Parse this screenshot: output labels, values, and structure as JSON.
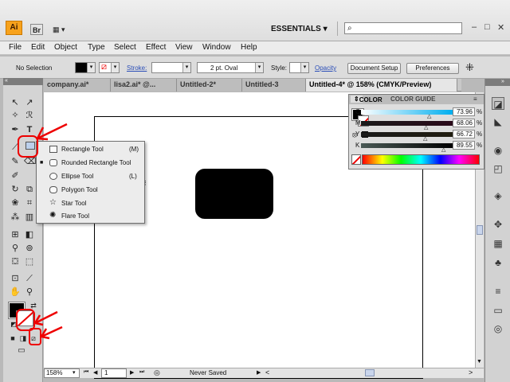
{
  "app": {
    "logo": "Ai",
    "bridge": "Br",
    "workspace": "ESSENTIALS",
    "search_placeholder": ""
  },
  "menu": [
    "File",
    "Edit",
    "Object",
    "Type",
    "Select",
    "Effect",
    "View",
    "Window",
    "Help"
  ],
  "control": {
    "selection": "No Selection",
    "stroke_label": "Stroke:",
    "brush": "2 pt. Oval",
    "style_label": "Style:",
    "opacity_label": "Opacity",
    "doc_setup": "Document Setup",
    "preferences": "Preferences"
  },
  "tabs": [
    "company.ai*",
    "lisa2.ai* @...",
    "Untitled-2*",
    "Untitled-3",
    "Untitled-4* @ 158% (CMYK/Preview)"
  ],
  "color_panel": {
    "tab_color": "COLOR",
    "tab_guide": "COLOR GUIDE",
    "rows": [
      {
        "label": "C",
        "value": "73.96",
        "pct": "%"
      },
      {
        "label": "M",
        "value": "68.06",
        "pct": "%"
      },
      {
        "label": "Y",
        "value": "66.72",
        "pct": "%"
      },
      {
        "label": "K",
        "value": "89.55",
        "pct": "%"
      }
    ]
  },
  "flyout": [
    {
      "label": "Rectangle Tool",
      "key": "(M)"
    },
    {
      "label": "Rounded Rectangle Tool",
      "key": ""
    },
    {
      "label": "Ellipse Tool",
      "key": "(L)"
    },
    {
      "label": "Polygon Tool",
      "key": ""
    },
    {
      "label": "Star Tool",
      "key": ""
    },
    {
      "label": "Flare Tool",
      "key": ""
    }
  ],
  "status": {
    "zoom": "158%",
    "page": "1",
    "saved": "Never Saved"
  },
  "colors": {
    "accent": "#f7a21c",
    "annotation": "#e00000",
    "shape": "#000000"
  }
}
